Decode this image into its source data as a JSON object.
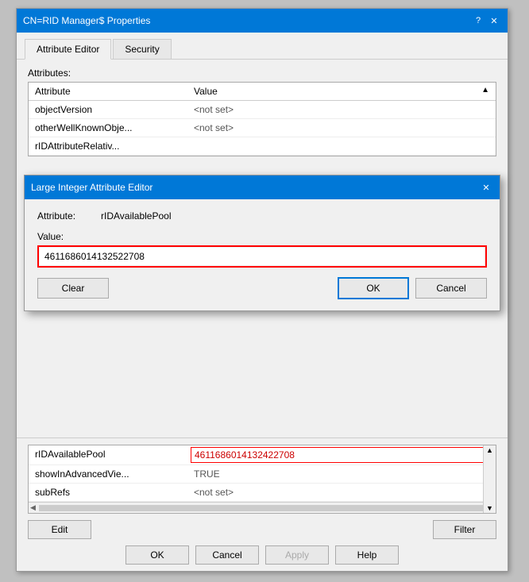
{
  "bgWindow": {
    "title": "CN=RID Manager$ Properties",
    "helpBtn": "?",
    "closeBtn": "✕",
    "tabs": [
      {
        "label": "Attribute Editor",
        "active": true
      },
      {
        "label": "Security",
        "active": false
      }
    ],
    "attributesLabel": "Attributes:",
    "tableHeaders": [
      "Attribute",
      "Value"
    ],
    "tableRows": [
      {
        "attr": "objectVersion",
        "value": "<not set>",
        "highlight": false
      },
      {
        "attr": "otherWellKnownObje...",
        "value": "<not set>",
        "highlight": false
      },
      {
        "attr": "rIDAttributeRelativ...",
        "value": "",
        "highlight": false
      }
    ],
    "bottomRows": [
      {
        "attr": "rIDAvailablePool",
        "value": "4611686014132422708",
        "highlight": true
      },
      {
        "attr": "showInAdvancedVie...",
        "value": "TRUE",
        "highlight": false
      },
      {
        "attr": "subRefs",
        "value": "<not set>",
        "highlight": false
      }
    ],
    "editBtn": "Edit",
    "filterBtn": "Filter",
    "okBtn": "OK",
    "cancelBtn": "Cancel",
    "applyBtn": "Apply",
    "helpBtn2": "Help"
  },
  "fgDialog": {
    "title": "Large Integer Attribute Editor",
    "closeBtn": "✕",
    "attributeLabel": "Attribute:",
    "attributeValue": "rIDAvailablePool",
    "valueLabel": "Value:",
    "inputValue": "4611686014132522708",
    "clearBtn": "Clear",
    "okBtn": "OK",
    "cancelBtn": "Cancel"
  }
}
